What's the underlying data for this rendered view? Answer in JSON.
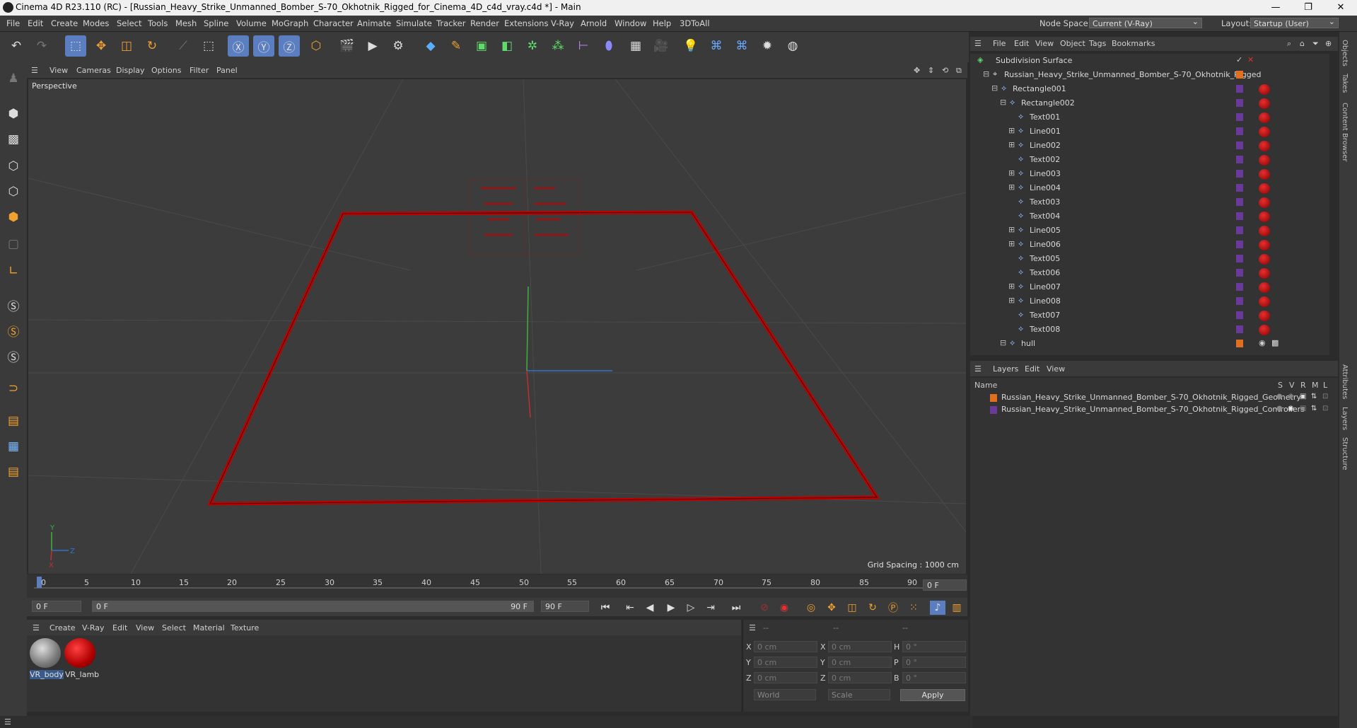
{
  "window": {
    "title": "Cinema 4D R23.110 (RC) - [Russian_Heavy_Strike_Unmanned_Bomber_S-70_Okhotnik_Rigged_for_Cinema_4D_c4d_vray.c4d *] - Main",
    "minimize": "—",
    "maximize": "❐",
    "close": "✕"
  },
  "menubar": {
    "items": [
      "File",
      "Edit",
      "Create",
      "Modes",
      "Select",
      "Tools",
      "Mesh",
      "Spline",
      "Volume",
      "MoGraph",
      "Character",
      "Animate",
      "Simulate",
      "Tracker",
      "Render",
      "Extensions",
      "V-Ray",
      "Arnold",
      "Window",
      "Help",
      "3DToAll"
    ],
    "node_space_label": "Node Space:",
    "node_space_value": "Current (V-Ray)",
    "layout_label": "Layout:",
    "layout_value": "Startup (User)"
  },
  "viewport": {
    "menu": [
      "View",
      "Cameras",
      "Display",
      "Options",
      "Filter",
      "Panel"
    ],
    "label": "Perspective",
    "grid_spacing": "Grid Spacing : 1000 cm",
    "axis_y": "Y",
    "axis_z": "Z",
    "axis_x": "X"
  },
  "timeline": {
    "ticks": [
      "0",
      "5",
      "10",
      "15",
      "20",
      "25",
      "30",
      "35",
      "40",
      "45",
      "50",
      "55",
      "60",
      "65",
      "70",
      "75",
      "80",
      "85",
      "90"
    ],
    "current_frame": "0 F",
    "start_field": "0 F",
    "range_start": "0 F",
    "range_end": "90 F",
    "end_field": "90 F"
  },
  "materials": {
    "menu": [
      "Create",
      "V-Ray",
      "Edit",
      "View",
      "Select",
      "Material",
      "Texture"
    ],
    "items": [
      {
        "name": "VR_body"
      },
      {
        "name": "VR_lamb"
      }
    ]
  },
  "coordinates": {
    "header": [
      "--",
      "--",
      "--"
    ],
    "rows": [
      {
        "l1": "X",
        "v1": "0 cm",
        "l2": "X",
        "v2": "0 cm",
        "l3": "H",
        "v3": "0 °"
      },
      {
        "l1": "Y",
        "v1": "0 cm",
        "l2": "Y",
        "v2": "0 cm",
        "l3": "P",
        "v3": "0 °"
      },
      {
        "l1": "Z",
        "v1": "0 cm",
        "l2": "Z",
        "v2": "0 cm",
        "l3": "B",
        "v3": "0 °"
      }
    ],
    "mode1": "World",
    "mode2": "Scale",
    "apply": "Apply"
  },
  "objects": {
    "menu": [
      "File",
      "Edit",
      "View",
      "Object",
      "Tags",
      "Bookmarks"
    ],
    "rows": [
      {
        "name": "Subdivision Surface",
        "indent": 0
      },
      {
        "name": "Russian_Heavy_Strike_Unmanned_Bomber_S-70_Okhotnik_Rigged",
        "indent": 1
      },
      {
        "name": "Rectangle001",
        "indent": 2
      },
      {
        "name": "Rectangle002",
        "indent": 3
      },
      {
        "name": "Text001",
        "indent": 4
      },
      {
        "name": "Line001",
        "indent": 4
      },
      {
        "name": "Line002",
        "indent": 4
      },
      {
        "name": "Text002",
        "indent": 4
      },
      {
        "name": "Line003",
        "indent": 4
      },
      {
        "name": "Line004",
        "indent": 4
      },
      {
        "name": "Text003",
        "indent": 4
      },
      {
        "name": "Text004",
        "indent": 4
      },
      {
        "name": "Line005",
        "indent": 4
      },
      {
        "name": "Line006",
        "indent": 4
      },
      {
        "name": "Text005",
        "indent": 4
      },
      {
        "name": "Text006",
        "indent": 4
      },
      {
        "name": "Line007",
        "indent": 4
      },
      {
        "name": "Line008",
        "indent": 4
      },
      {
        "name": "Text007",
        "indent": 4
      },
      {
        "name": "Text008",
        "indent": 4
      },
      {
        "name": "hull",
        "indent": 3
      }
    ]
  },
  "layers": {
    "menu": [
      "Layers",
      "Edit",
      "View"
    ],
    "columns": {
      "name": "Name",
      "s": "S",
      "v": "V",
      "r": "R",
      "m": "M",
      "l": "L"
    },
    "rows": [
      {
        "name": "Russian_Heavy_Strike_Unmanned_Bomber_S-70_Okhotnik_Rigged_Geometry",
        "color": "#e07020"
      },
      {
        "name": "Russian_Heavy_Strike_Unmanned_Bomber_S-70_Okhotnik_Rigged_Controllers",
        "color": "#6a3a9a"
      }
    ]
  },
  "side_tabs": [
    "Objects",
    "Takes",
    "Content Browser",
    "Attributes",
    "Layers",
    "Structure"
  ]
}
